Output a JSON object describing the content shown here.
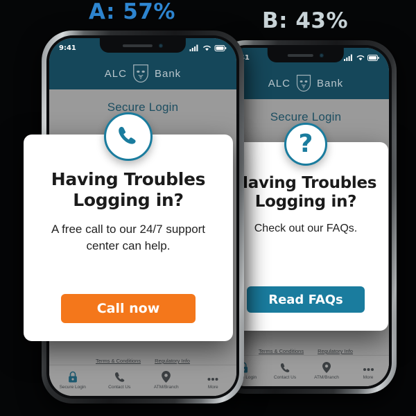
{
  "experiment": {
    "variant_a_label": "A: 57%",
    "variant_b_label": "B: 43%",
    "variant_a_color": "#2e86d1",
    "variant_b_color": "#c9d4d8"
  },
  "phone": {
    "status_time": "9:41",
    "brand_left": "ALC",
    "brand_right": "Bank",
    "page_title": "Secure Login",
    "legal_links": [
      "Terms & Conditions",
      "Regulatory Info"
    ],
    "tabs": [
      {
        "label": "Secure Login",
        "icon": "lock-icon"
      },
      {
        "label": "Contact Us",
        "icon": "phone-icon"
      },
      {
        "label": "ATM/Branch",
        "icon": "map-pin-icon"
      },
      {
        "label": "More",
        "icon": "ellipsis-icon"
      }
    ],
    "header_color": "#15475a",
    "dim_color": "#9a9a9a"
  },
  "variant_a": {
    "badge_icon": "phone-handset-icon",
    "title_line1": "Having Troubles",
    "title_line2": "Logging in?",
    "body": "A free call to our 24/7 support center can help.",
    "cta_label": "Call now",
    "cta_color": "#f4771b"
  },
  "variant_b": {
    "badge_icon": "question-mark-icon",
    "badge_glyph": "?",
    "title_line1": "Having Troubles",
    "title_line2": "Logging in?",
    "body": "Check out our FAQs.",
    "cta_label": "Read FAQs",
    "cta_color": "#1a7c9e"
  }
}
